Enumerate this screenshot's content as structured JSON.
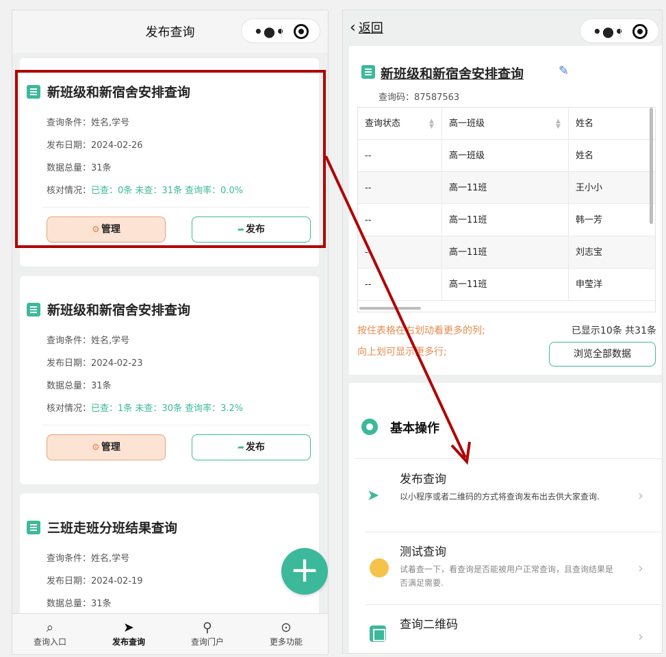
{
  "left": {
    "title": "发布查询",
    "cards": [
      {
        "title": "新班级和新宿舍安排查询",
        "cond_label": "查询条件：",
        "cond": "姓名,学号",
        "date_label": "发布日期：",
        "date": "2024-02-26",
        "total_label": "数据总量：",
        "total": "31条",
        "check_label": "核对情况：",
        "check": "已查：0条 未查：31条 查询率：0.0%",
        "manage": "管理",
        "publish": "发布"
      },
      {
        "title": "新班级和新宿舍安排查询",
        "cond_label": "查询条件：",
        "cond": "姓名,学号",
        "date_label": "发布日期：",
        "date": "2024-02-23",
        "total_label": "数据总量：",
        "total": "31条",
        "check_label": "核对情况：",
        "check": "已查：1条 未查：30条 查询率：3.2%",
        "manage": "管理",
        "publish": "发布"
      },
      {
        "title": "三班走班分班结果查询",
        "cond_label": "查询条件：",
        "cond": "姓名,学号",
        "date_label": "发布日期：",
        "date": "2024-02-19",
        "total_label": "数据总量：",
        "total": "31条"
      }
    ],
    "fab": "+",
    "tabs": [
      {
        "label": "查询入口",
        "icon": "search-icon"
      },
      {
        "label": "发布查询",
        "icon": "send-icon"
      },
      {
        "label": "查询门户",
        "icon": "sitemap-icon"
      },
      {
        "label": "更多功能",
        "icon": "more-icon"
      }
    ]
  },
  "right": {
    "back": "返回",
    "title": "新班级和新宿舍安排查询",
    "code": "查询码：87587563",
    "table": {
      "headers": [
        "查询状态",
        "高一班级",
        "姓名"
      ],
      "rows": [
        [
          "--",
          "高一班级",
          "姓名"
        ],
        [
          "--",
          "高一11班",
          "王小小"
        ],
        [
          "--",
          "高一11班",
          "韩一芳"
        ],
        [
          "--",
          "高一11班",
          "刘志宝"
        ],
        [
          "--",
          "高一11班",
          "申莹洋"
        ]
      ]
    },
    "tip1": "按住表格在右划动看更多的列;",
    "tip2": "向上划可显示更多行;",
    "count": "已显示10条 共31条",
    "browse": "浏览全部数据",
    "section_title": "基本操作",
    "items": [
      {
        "name": "发布查询",
        "desc": "以小程序或者二维码的方式将查询发布出去供大家查询."
      },
      {
        "name": "测试查询",
        "desc": "试着查一下，看查询是否能被用户正常查询，且查询结果是否满足需要."
      },
      {
        "name": "查询二维码",
        "desc": ""
      }
    ]
  },
  "colors": {
    "accent": "#3cb99a",
    "highlight": "#b00000",
    "manage_bg": "#fde3d3",
    "tip": "#e58a4e"
  }
}
